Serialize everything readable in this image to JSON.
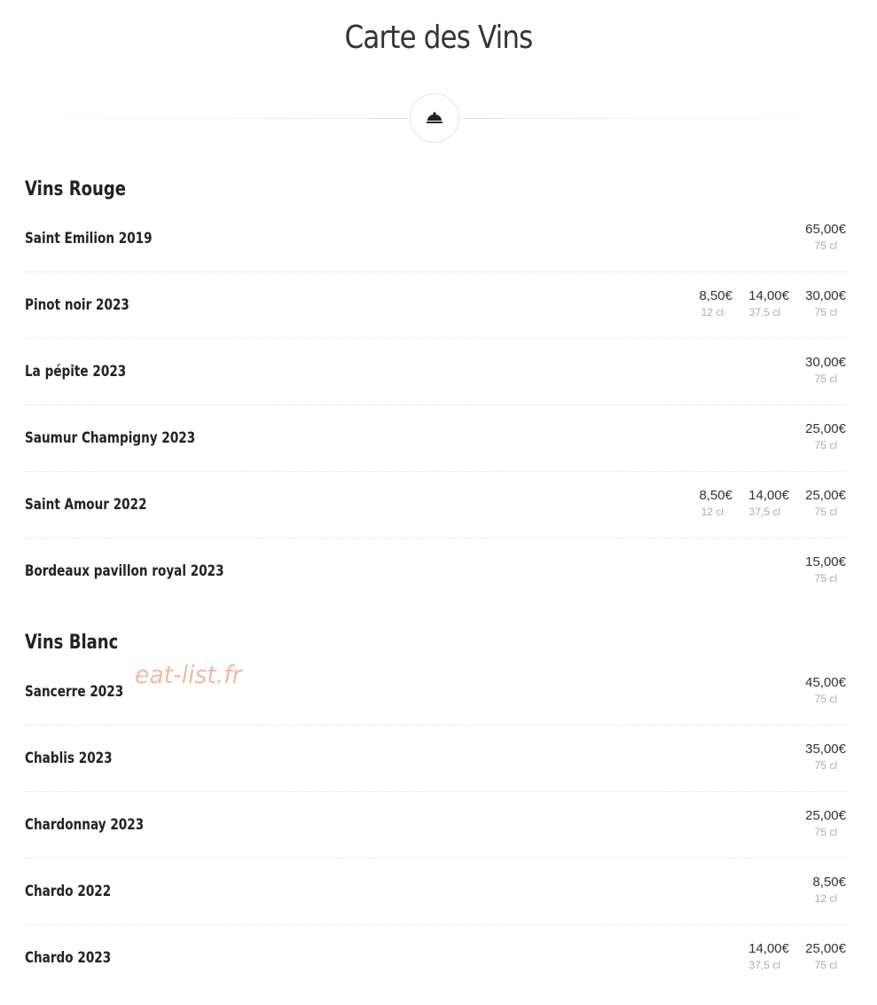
{
  "page": {
    "title": "Carte des Vins",
    "watermark": "eat-list.fr"
  },
  "sections": [
    {
      "title": "Vins Rouge",
      "items": [
        {
          "name": "Saint Emilion 2019",
          "prices": [
            {
              "value": "65,00€",
              "size": "75 cl"
            }
          ]
        },
        {
          "name": "Pinot noir 2023",
          "prices": [
            {
              "value": "8,50€",
              "size": "12 cl"
            },
            {
              "value": "14,00€",
              "size": "37,5 cl"
            },
            {
              "value": "30,00€",
              "size": "75 cl"
            }
          ]
        },
        {
          "name": "La pépite 2023",
          "prices": [
            {
              "value": "30,00€",
              "size": "75 cl"
            }
          ]
        },
        {
          "name": "Saumur Champigny 2023",
          "prices": [
            {
              "value": "25,00€",
              "size": "75 cl"
            }
          ]
        },
        {
          "name": "Saint Amour 2022",
          "prices": [
            {
              "value": "8,50€",
              "size": "12 cl"
            },
            {
              "value": "14,00€",
              "size": "37,5 cl"
            },
            {
              "value": "25,00€",
              "size": "75 cl"
            }
          ]
        },
        {
          "name": "Bordeaux pavillon royal 2023",
          "prices": [
            {
              "value": "15,00€",
              "size": "75 cl"
            }
          ]
        }
      ]
    },
    {
      "title": "Vins Blanc",
      "items": [
        {
          "name": "Sancerre 2023",
          "prices": [
            {
              "value": "45,00€",
              "size": "75 cl"
            }
          ]
        },
        {
          "name": "Chablis 2023",
          "prices": [
            {
              "value": "35,00€",
              "size": "75 cl"
            }
          ]
        },
        {
          "name": "Chardonnay 2023",
          "prices": [
            {
              "value": "25,00€",
              "size": "75 cl"
            }
          ]
        },
        {
          "name": "Chardo 2022",
          "prices": [
            {
              "value": "8,50€",
              "size": "12 cl"
            }
          ]
        },
        {
          "name": "Chardo 2023",
          "prices": [
            {
              "value": "14,00€",
              "size": "37,5 cl"
            },
            {
              "value": "25,00€",
              "size": "75 cl"
            }
          ]
        }
      ]
    }
  ],
  "icons": {
    "divider_icon": "cloche-icon"
  },
  "colors": {
    "text": "#222222",
    "muted": "#aaaaaa",
    "watermark": "#f0b494",
    "divider": "#e2e2e2"
  }
}
